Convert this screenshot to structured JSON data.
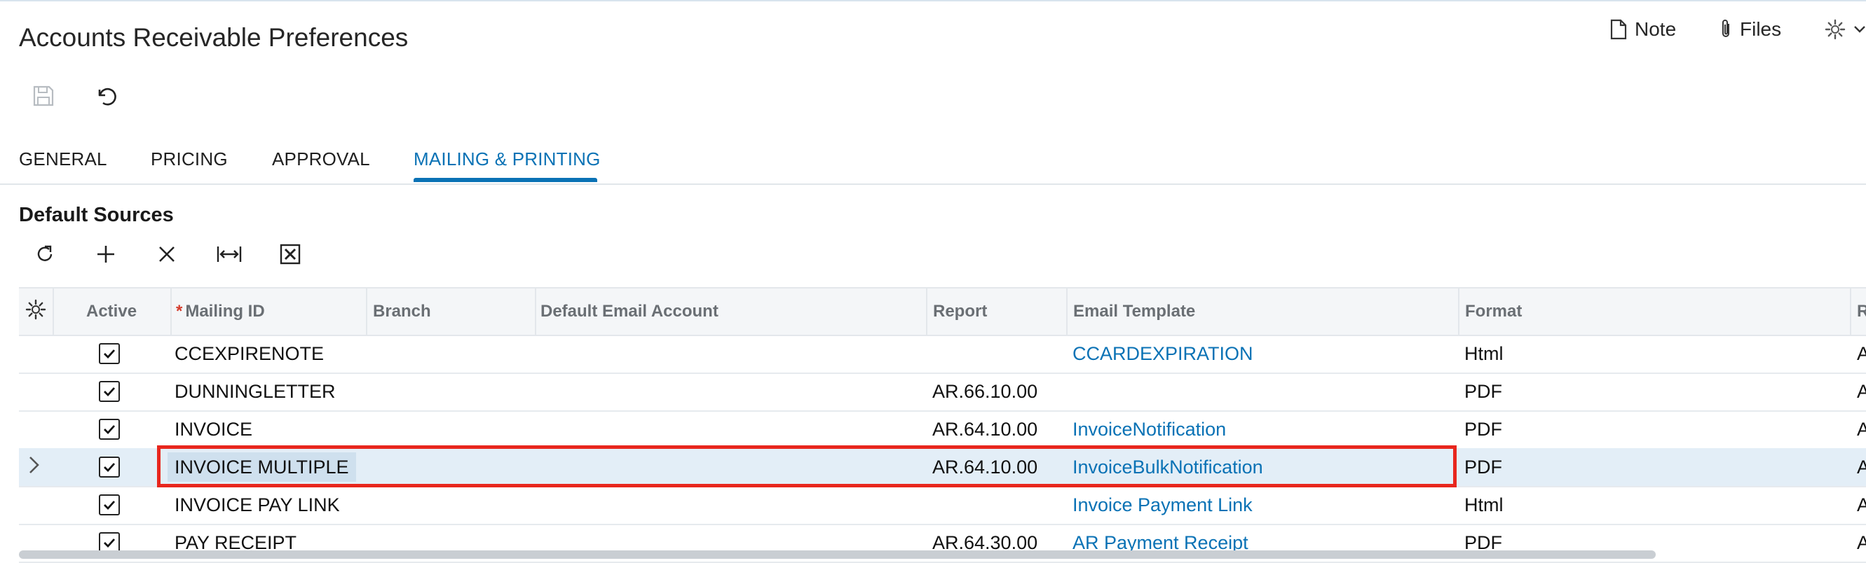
{
  "page": {
    "title": "Accounts Receivable Preferences"
  },
  "header_actions": {
    "note_label": "Note",
    "files_label": "Files",
    "note_icon": "document-icon",
    "files_icon": "paperclip-icon",
    "settings_icon": "gear-icon"
  },
  "toolbar": {
    "save_icon": "save-icon",
    "undo_icon": "undo-icon"
  },
  "tabs": [
    {
      "label": "GENERAL",
      "active": false
    },
    {
      "label": "PRICING",
      "active": false
    },
    {
      "label": "APPROVAL",
      "active": false
    },
    {
      "label": "MAILING & PRINTING",
      "active": true
    }
  ],
  "section": {
    "title": "Default Sources"
  },
  "grid_toolbar": {
    "icons": [
      "refresh-icon",
      "add-icon",
      "delete-icon",
      "fit-columns-icon",
      "excel-export-icon"
    ]
  },
  "grid": {
    "columns": {
      "settings_icon": "gear-icon",
      "active": "Active",
      "mailing_id_required": "*",
      "mailing_id": "Mailing ID",
      "branch": "Branch",
      "default_email_account": "Default Email Account",
      "report": "Report",
      "email_template": "Email Template",
      "format": "Format",
      "next": "R"
    },
    "rows": [
      {
        "active": true,
        "mailing_id": "CCEXPIRENOTE",
        "branch": "",
        "default_email_account": "",
        "report": "",
        "email_template": "CCARDEXPIRATION",
        "format": "Html",
        "next": "A"
      },
      {
        "active": true,
        "mailing_id": "DUNNINGLETTER",
        "branch": "",
        "default_email_account": "",
        "report": "AR.66.10.00",
        "email_template": "",
        "format": "PDF",
        "next": "A"
      },
      {
        "active": true,
        "mailing_id": "INVOICE",
        "branch": "",
        "default_email_account": "",
        "report": "AR.64.10.00",
        "email_template": "InvoiceNotification",
        "format": "PDF",
        "next": "A"
      },
      {
        "active": true,
        "mailing_id": "INVOICE MULTIPLE",
        "branch": "",
        "default_email_account": "",
        "report": "AR.64.10.00",
        "email_template": "InvoiceBulkNotification",
        "format": "PDF",
        "next": "A",
        "selected": true
      },
      {
        "active": true,
        "mailing_id": "INVOICE PAY LINK",
        "branch": "",
        "default_email_account": "",
        "report": "",
        "email_template": "Invoice Payment Link",
        "format": "Html",
        "next": "A"
      },
      {
        "active": true,
        "mailing_id": "PAY RECEIPT",
        "branch": "",
        "default_email_account": "",
        "report": "AR.64.30.00",
        "email_template": "AR Payment Receipt",
        "format": "PDF",
        "next": "A"
      }
    ]
  },
  "colors": {
    "accent": "#0a72b5",
    "highlight_border": "#e8261d",
    "selected_row": "#e3eef7"
  }
}
